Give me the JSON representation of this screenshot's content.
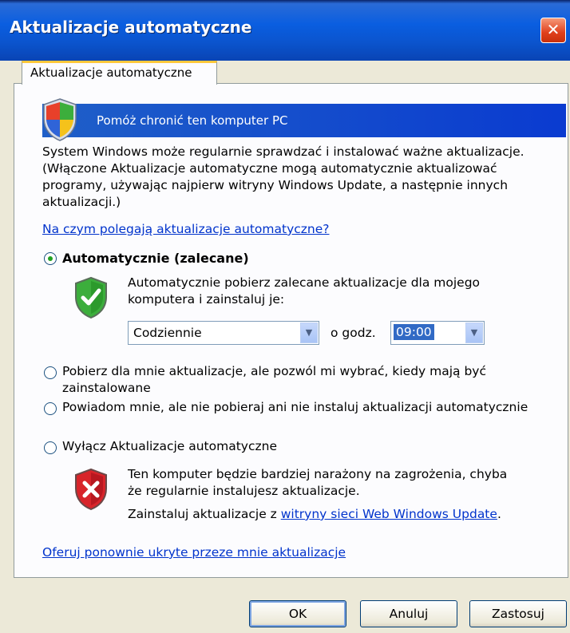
{
  "window": {
    "title": "Aktualizacje automatyczne",
    "close_glyph": "✕"
  },
  "tab": {
    "label": "Aktualizacje automatyczne"
  },
  "banner": {
    "text": "Pomóż chronić ten komputer PC",
    "icon": "windows-security-shield-icon"
  },
  "intro": {
    "line1": "System Windows może regularnie sprawdzać i instalować ważne aktualizacje.",
    "line2": "(Włączone Aktualizacje automatyczne mogą automatycznie aktualizować",
    "line3": "programy, używając najpierw witryny Windows Update, a następnie innych",
    "line4": "aktualizacji.)"
  },
  "help_link": "Na czym polegają aktualizacje automatyczne?",
  "options": {
    "auto": {
      "label": "Automatycznie (zalecane)",
      "checked": true,
      "desc_line1": "Automatycznie pobierz zalecane aktualizacje dla mojego",
      "desc_line2": "komputera i zainstaluj je:",
      "frequency": "Codziennie",
      "at_label": "o godz.",
      "time": "09:00",
      "icon": "green-check-shield-icon"
    },
    "download": {
      "label_line1": "Pobierz dla mnie aktualizacje, ale pozwól mi wybrać, kiedy mają być",
      "label_line2": "zainstalowane",
      "checked": false
    },
    "notify": {
      "label": "Powiadom mnie, ale nie pobieraj ani nie instaluj aktualizacji automatycznie",
      "checked": false
    },
    "off": {
      "label": "Wyłącz Aktualizacje automatyczne",
      "checked": false,
      "warn_line1": "Ten komputer będzie bardziej narażony na zagrożenia, chyba",
      "warn_line2": "że regularnie instalujesz aktualizacje.",
      "install_prefix": "Zainstaluj aktualizacje z ",
      "install_link": "witryny sieci Web Windows Update",
      "install_suffix": ".",
      "icon": "red-x-shield-icon"
    }
  },
  "hidden_link": "Oferuj ponownie ukryte przeze mnie aktualizacje",
  "buttons": {
    "ok": "OK",
    "cancel": "Anuluj",
    "apply": "Zastosuj"
  },
  "colors": {
    "titlebar": "#0A5EE0",
    "banner": "#1F5FC8",
    "link": "#0033CC",
    "face": "#ECE9D8"
  }
}
